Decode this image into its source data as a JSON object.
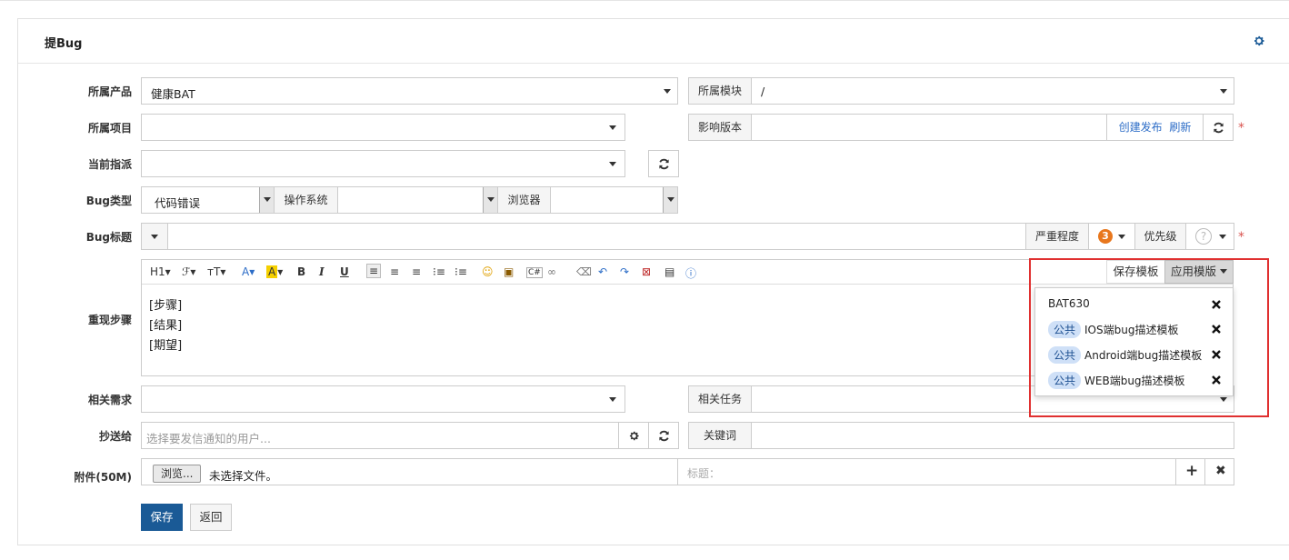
{
  "page": {
    "title": "提Bug"
  },
  "labels": {
    "product": "所属产品",
    "project": "所属项目",
    "assign": "当前指派",
    "bug_type": "Bug类型",
    "bug_title": "Bug标题",
    "steps": "重现步骤",
    "story": "相关需求",
    "mailto": "抄送给",
    "files": "附件(50M)"
  },
  "fields": {
    "product_value": "健康BAT",
    "module_label": "所属模块",
    "module_value": "/",
    "build_label": "影响版本",
    "create_release": "创建发布",
    "refresh": "刷新",
    "bug_type_value": "代码错误",
    "os_label": "操作系统",
    "browser_label": "浏览器",
    "severity_label": "严重程度",
    "severity_value": "3",
    "priority_label": "优先级",
    "priority_value": "?",
    "task_label": "相关任务",
    "mailto_placeholder": "选择要发信通知的用户...",
    "keywords_label": "关键词",
    "browse_button": "浏览...",
    "no_file": "未选择文件。",
    "file_title_placeholder": "标题："
  },
  "editor": {
    "lines": [
      "[步骤]",
      "[结果]",
      "[期望]"
    ],
    "save_template": "保存模板",
    "apply_template": "应用模版"
  },
  "template_menu": {
    "items": [
      {
        "tag": "",
        "name": "BAT630"
      },
      {
        "tag": "公共",
        "name": "IOS端bug描述模板"
      },
      {
        "tag": "公共",
        "name": "Android端bug描述模板"
      },
      {
        "tag": "公共",
        "name": "WEB端bug描述模板"
      }
    ]
  },
  "actions": {
    "save": "保存",
    "back": "返回"
  },
  "colors": {
    "primary": "#1a5a96",
    "required": "#d9534f",
    "highlight": "#e03030",
    "severity": "#e8771d"
  }
}
